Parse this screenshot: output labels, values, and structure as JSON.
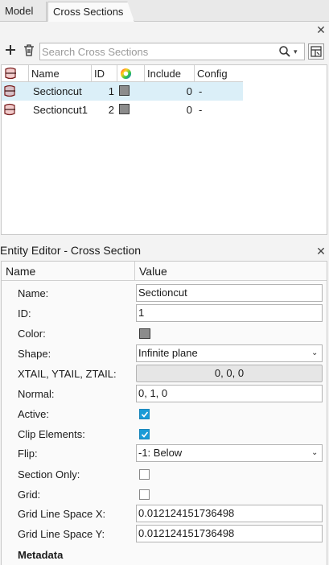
{
  "tabs": [
    {
      "label": "Model"
    },
    {
      "label": "Cross Sections"
    }
  ],
  "toolbar": {
    "search_placeholder": "Search Cross Sections",
    "icons": [
      "add-icon",
      "trash-icon",
      "search-icon",
      "dropdown-icon",
      "browser-config-icon"
    ]
  },
  "list": {
    "columns": [
      "Name",
      "ID",
      "",
      "Include",
      "Config"
    ],
    "rows": [
      {
        "name": "Sectioncut",
        "id": "1",
        "color": "#8c8c8c",
        "include": "0",
        "config": "-",
        "selected": true
      },
      {
        "name": "Sectioncut1",
        "id": "2",
        "color": "#8c8c8c",
        "include": "0",
        "config": "-",
        "selected": false
      }
    ]
  },
  "editor": {
    "title": "Entity Editor - Cross Section",
    "col_name": "Name",
    "col_value": "Value",
    "labels": {
      "name": "Name:",
      "id": "ID:",
      "color": "Color:",
      "shape": "Shape:",
      "tail": "XTAIL, YTAIL, ZTAIL:",
      "normal": "Normal:",
      "active": "Active:",
      "clip": "Clip Elements:",
      "flip": "Flip:",
      "section_only": "Section Only:",
      "grid": "Grid:",
      "grid_x": "Grid Line Space X:",
      "grid_y": "Grid Line Space Y:"
    },
    "values": {
      "name": "Sectioncut",
      "id": "1",
      "color": "#8c8c8c",
      "shape": "Infinite plane",
      "tail": "0, 0, 0",
      "normal": "0, 1, 0",
      "active": true,
      "clip": true,
      "flip": "-1: Below",
      "section_only": false,
      "grid": false,
      "grid_x": "0.012124151736498",
      "grid_y": "0.012124151736498"
    },
    "metadata_label": "Metadata"
  },
  "colors": {
    "selection": "#dbeff8",
    "checkbox_on": "#1a9bd7",
    "swatch": "#8c8c8c"
  }
}
